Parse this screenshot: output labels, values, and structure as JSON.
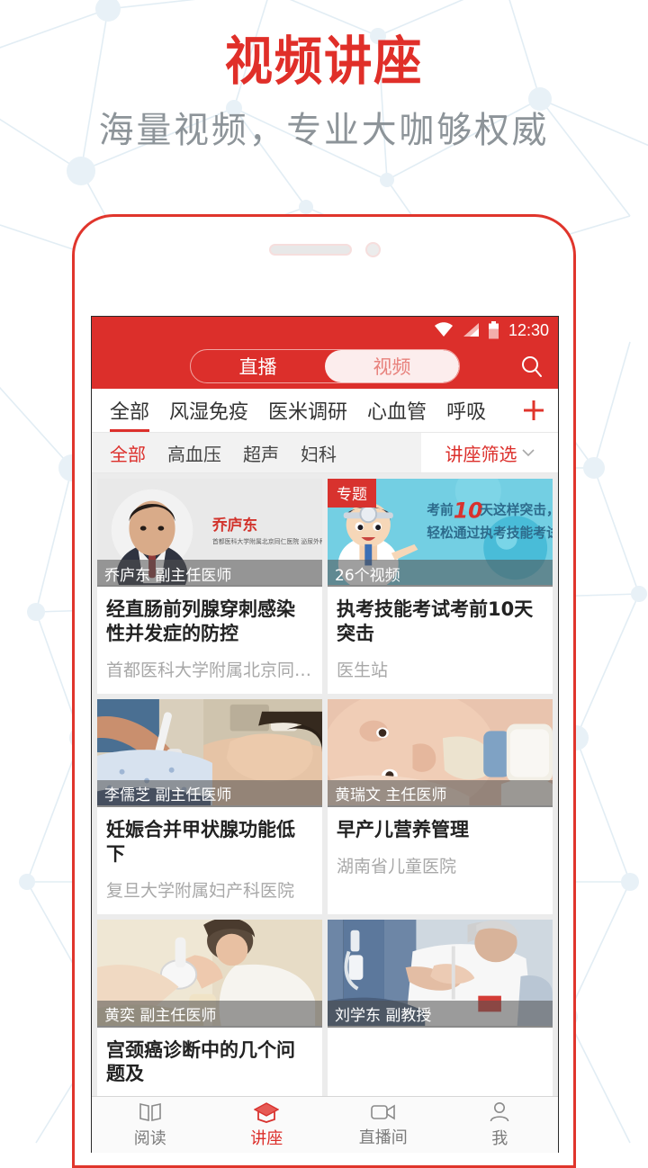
{
  "promo": {
    "title": "视频讲座",
    "subtitle": "海量视频，专业大咖够权威",
    "title_color": "#e02f29",
    "subtitle_color": "#8d9499"
  },
  "statusbar": {
    "time": "12:30",
    "icons": [
      "wifi-icon",
      "signal-icon",
      "battery-icon"
    ]
  },
  "appbar": {
    "brand_color": "#dc2f2b",
    "segments": [
      {
        "label": "直播",
        "active": false
      },
      {
        "label": "视频",
        "active": true
      }
    ],
    "search_icon": "search-icon"
  },
  "tabs_primary": {
    "items": [
      {
        "label": "全部",
        "active": true
      },
      {
        "label": "风湿免疫",
        "active": false
      },
      {
        "label": "医米调研",
        "active": false
      },
      {
        "label": "心血管",
        "active": false
      },
      {
        "label": "呼吸",
        "active": false
      }
    ],
    "add_icon": "plus-icon"
  },
  "tabs_secondary": {
    "items": [
      {
        "label": "全部",
        "active": true
      },
      {
        "label": "高血压",
        "active": false
      },
      {
        "label": "超声",
        "active": false
      },
      {
        "label": "妇科",
        "active": false
      }
    ],
    "filter": {
      "label": "讲座筛选",
      "icon": "chevron-down-icon"
    }
  },
  "cards": [
    {
      "thumb_kind": "doctor-portrait",
      "badge": null,
      "overlay": "乔庐东 副主任医师",
      "portrait_name": "乔庐东",
      "portrait_affil": "首都医科大学附属北京同仁医院 泌尿外科",
      "title": "经直肠前列腺穿刺感染性并发症的防控",
      "source": "首都医科大学附属北京同…"
    },
    {
      "thumb_kind": "cartoon-exam",
      "badge": "专题",
      "overlay": "26个视频",
      "banner_line1": "考前10天这样突击，",
      "banner_line2": "轻松通过执考技能考试！",
      "title": "执考技能考试考前10天突击",
      "source": "医生站"
    },
    {
      "thumb_kind": "ultrasound",
      "badge": null,
      "overlay": "李儒芝 副主任医师",
      "title": "妊娠合并甲状腺功能低下",
      "source": "复旦大学附属妇产科医院"
    },
    {
      "thumb_kind": "baby-bottle",
      "badge": null,
      "overlay": "黄瑞文 主任医师",
      "title": "早产儿营养管理",
      "source": "湖南省儿童医院"
    },
    {
      "thumb_kind": "exam-room",
      "badge": null,
      "overlay": "黄奕 副主任医师",
      "title": "宫颈癌诊断中的几个问题及",
      "source": ""
    },
    {
      "thumb_kind": "elderly-care",
      "badge": null,
      "overlay": "刘学东 副教授",
      "title": "",
      "source": ""
    }
  ],
  "bottomnav": {
    "items": [
      {
        "label": "阅读",
        "icon": "book-icon",
        "active": false
      },
      {
        "label": "讲座",
        "icon": "graduation-cap-icon",
        "active": true
      },
      {
        "label": "直播间",
        "icon": "video-camera-icon",
        "active": false
      },
      {
        "label": "我",
        "icon": "person-icon",
        "active": false
      }
    ]
  }
}
